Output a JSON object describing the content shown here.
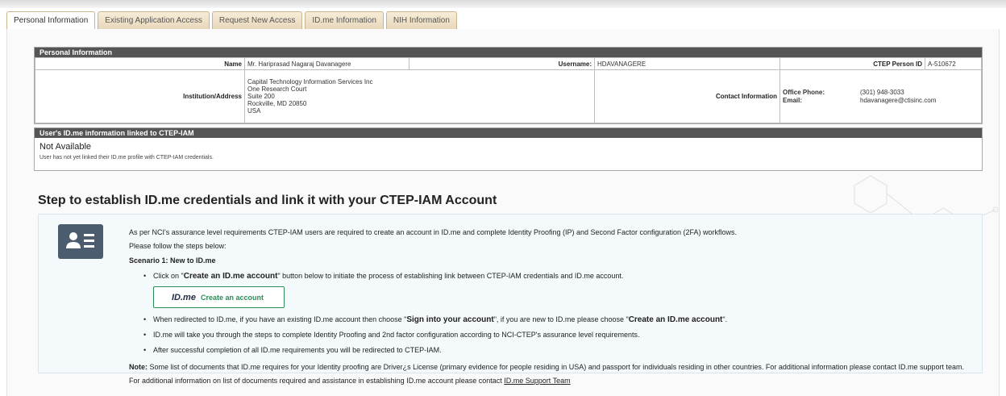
{
  "tabs": [
    {
      "label": "Personal Information",
      "active": true
    },
    {
      "label": "Existing Application Access",
      "active": false
    },
    {
      "label": "Request New Access",
      "active": false
    },
    {
      "label": "ID.me Information",
      "active": false
    },
    {
      "label": "NIH Information",
      "active": false
    }
  ],
  "personal": {
    "header": "Personal Information",
    "name_label": "Name",
    "name_value": "Mr. Hariprasad Nagaraj Davanagere",
    "username_label": "Username:",
    "username_value": "HDAVANAGERE",
    "ctep_label": "CTEP Person ID",
    "ctep_value": "A-510672",
    "address_label": "Institution/Address",
    "address_lines": [
      "Capital Technology Information Services Inc",
      "One Research Court",
      "Suite 200",
      "Rockville, MD  20850",
      "USA"
    ],
    "contact_label": "Contact Information",
    "office_phone_label": "Office Phone:",
    "office_phone_value": "(301) 948-3033",
    "email_label": "Email:",
    "email_value": "hdavanagere@ctisinc.com"
  },
  "idme": {
    "header": "User's ID.me information linked to CTEP-IAM",
    "status": "Not Available",
    "note": "User has not yet linked their ID.me profile with CTEP-IAM credentials."
  },
  "steps": {
    "title": "Step to establish ID.me credentials and link it with your CTEP-IAM Account",
    "intro": "As per NCI's assurance level requirements CTEP-IAM users are required to create an account in ID.me and complete Identity Proofing (IP) and Second Factor configuration (2FA) workflows.",
    "follow": "Please follow the steps below:",
    "scenario": "Scenario 1: New to ID.me",
    "bullet1_pre": "Click on \"",
    "bullet1_bold": "Create an ID.me account",
    "bullet1_post": "\" button below to initiate the process of establishing link between CTEP-IAM credentials and ID.me account.",
    "button_brand": "ID.me",
    "button_label": "Create an account",
    "bullet2_a": "When redirected to ID.me, if you have an existing ID.me account then choose \"",
    "bullet2_b": "Sign into your account",
    "bullet2_c": "\", if you are new to ID.me please choose \"",
    "bullet2_d": "Create an ID.me account",
    "bullet2_e": "\".",
    "bullet3": "ID.me will take you through the steps to complete Identity Proofing and 2nd factor configuration according to NCI-CTEP's assurance level requirements.",
    "bullet4": "After successful completion of all ID.me requirements you will be redirected to CTEP-IAM.",
    "note_label": "Note:",
    "note_text": " Some list of documents that ID.me requires for your Identity proofing are Driver¿s License (primary evidence for people residing in USA) and passport for individuals residing in other countries. For additional information please contact ID.me support team. For additional information on list of documents required and assistance in establishing ID.me account please contact ",
    "support_link": "ID.me Support Team"
  }
}
